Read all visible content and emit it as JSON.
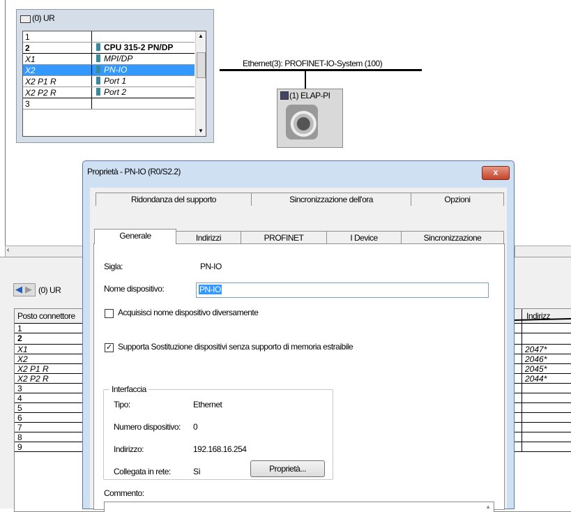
{
  "rack": {
    "title": "(0) UR",
    "rows": [
      {
        "slot": "1",
        "module": ""
      },
      {
        "slot": "2",
        "module": "CPU 315-2 PN/DP"
      },
      {
        "slot": "X1",
        "module": "MPI/DP"
      },
      {
        "slot": "X2",
        "module": "PN-IO"
      },
      {
        "slot": "X2 P1 R",
        "module": "Port 1"
      },
      {
        "slot": "X2 P2 R",
        "module": "Port 2"
      },
      {
        "slot": "3",
        "module": ""
      }
    ]
  },
  "network": {
    "label": "Ethernet(3): PROFINET-IO-System (100)"
  },
  "device": {
    "label": "(1) ELAP-PI"
  },
  "lower": {
    "rack_title": "(0) UR",
    "col_slot": "Posto connettore",
    "col_addr": "Indirizz",
    "rows": [
      {
        "slot": "1",
        "addr": ""
      },
      {
        "slot": "2",
        "addr": ""
      },
      {
        "slot": "X1",
        "addr": "2047*"
      },
      {
        "slot": "X2",
        "addr": "2046*"
      },
      {
        "slot": "X2 P1 R",
        "addr": "2045*"
      },
      {
        "slot": "X2 P2 R",
        "addr": "2044*"
      },
      {
        "slot": "3",
        "addr": ""
      },
      {
        "slot": "4",
        "addr": ""
      },
      {
        "slot": "5",
        "addr": ""
      },
      {
        "slot": "6",
        "addr": ""
      },
      {
        "slot": "7",
        "addr": ""
      },
      {
        "slot": "8",
        "addr": ""
      },
      {
        "slot": "9",
        "addr": ""
      }
    ]
  },
  "dialog": {
    "title": "Proprietà - PN-IO (R0/S2.2)",
    "close": "x",
    "tabs_back": [
      "Ridondanza del supporto",
      "Sincronizzazione dell'ora",
      "Opzioni"
    ],
    "tabs_front": [
      "Generale",
      "Indirizzi",
      "PROFINET",
      "I Device",
      "Sincronizzazione"
    ],
    "sigla_label": "Sigla:",
    "sigla_value": "PN-IO",
    "nome_label": "Nome dispositivo:",
    "nome_value": "PN-IO",
    "cb1_label": "Acquisisci nome dispositivo diversamente",
    "cb1_checked": false,
    "cb2_label": "Supporta Sostituzione dispositivi senza supporto di memoria estraibile",
    "cb2_checked": true,
    "interfaccia": {
      "title": "Interfaccia",
      "tipo_label": "Tipo:",
      "tipo_value": "Ethernet",
      "numero_label": "Numero dispositivo:",
      "numero_value": "0",
      "indirizzo_label": "Indirizzo:",
      "indirizzo_value": "192.168.16.254",
      "rete_label": "Collegata in rete:",
      "rete_value": "Sì",
      "prop_button": "Proprietà..."
    },
    "commento_label": "Commento:"
  }
}
